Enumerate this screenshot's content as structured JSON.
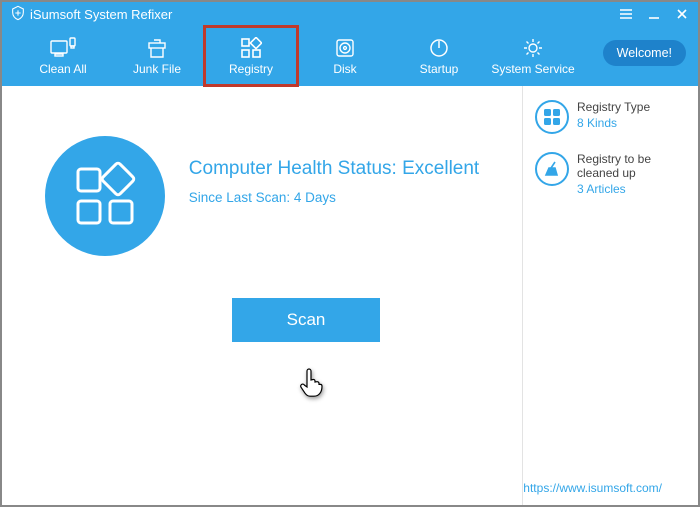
{
  "app": {
    "title": "iSumsoft System Refixer"
  },
  "nav": {
    "items": [
      {
        "label": "Clean All"
      },
      {
        "label": "Junk File"
      },
      {
        "label": "Registry"
      },
      {
        "label": "Disk"
      },
      {
        "label": "Startup"
      },
      {
        "label": "System Service"
      }
    ],
    "welcome": "Welcome!"
  },
  "main": {
    "status_heading": "Computer Health Status: Excellent",
    "status_sub": "Since Last Scan: 4 Days",
    "scan_label": "Scan"
  },
  "side": {
    "registry_type": {
      "title": "Registry Type",
      "value": "8 Kinds"
    },
    "to_clean": {
      "title": "Registry to be cleaned up",
      "value": "3 Articles"
    }
  },
  "footer": {
    "url": "https://www.isumsoft.com/"
  }
}
